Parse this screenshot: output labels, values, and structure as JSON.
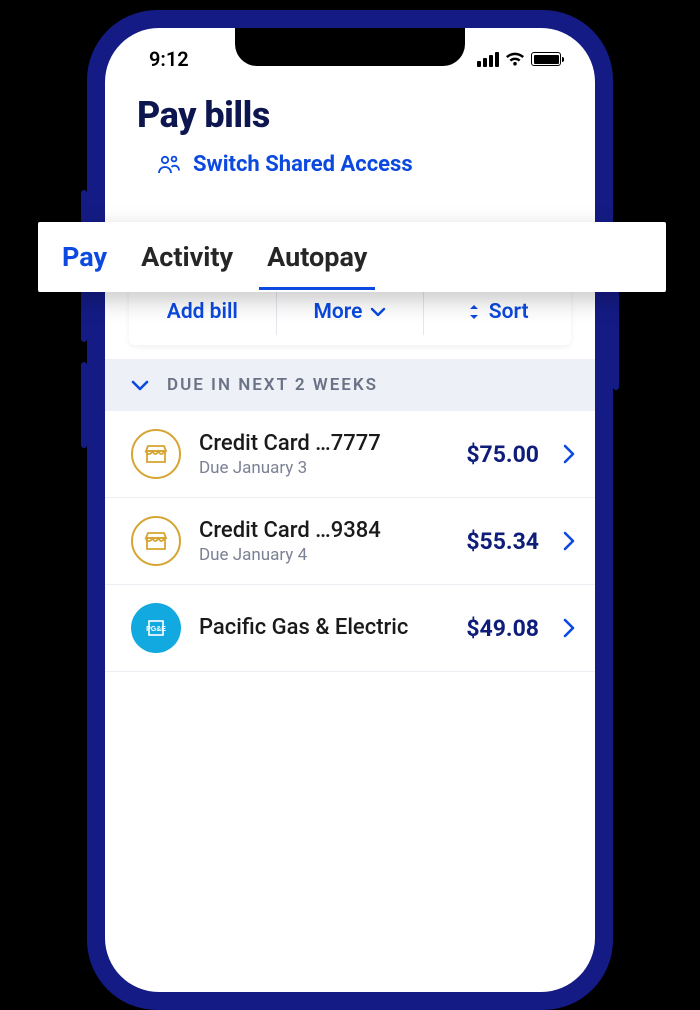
{
  "status": {
    "time": "9:12"
  },
  "title": "Pay bills",
  "shared_access": {
    "label": "Switch Shared Access"
  },
  "tabs": [
    {
      "label": "Pay",
      "active": true
    },
    {
      "label": "Activity",
      "active": false
    },
    {
      "label": "Autopay",
      "active": false,
      "underline": true
    }
  ],
  "actions": {
    "add_bill": "Add bill",
    "more": "More",
    "sort": "Sort"
  },
  "section_header": "DUE IN NEXT 2 WEEKS",
  "bills": [
    {
      "name": "Credit Card …7777",
      "due": "Due January 3",
      "amount": "$75.00",
      "icon": "store-icon",
      "style": "gold"
    },
    {
      "name": "Credit Card …9384",
      "due": "Due January 4",
      "amount": "$55.34",
      "icon": "store-icon",
      "style": "gold"
    },
    {
      "name": "Pacific Gas & Electric",
      "due": "",
      "amount": "$49.08",
      "icon": "pge-icon",
      "style": "blue"
    }
  ],
  "colors": {
    "accent": "#0b49e0",
    "brand": "#141b84"
  }
}
